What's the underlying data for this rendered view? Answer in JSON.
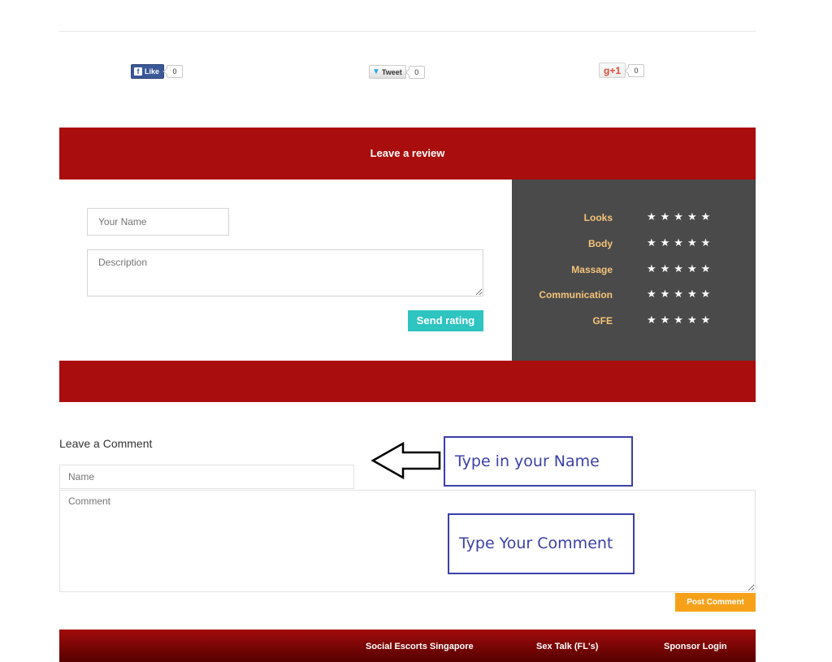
{
  "share": {
    "facebook": {
      "label": "Like",
      "count": "0"
    },
    "twitter": {
      "label": "Tweet",
      "count": "0"
    },
    "google": {
      "label": "g+1",
      "count": "0"
    }
  },
  "review": {
    "title": "Leave a review",
    "name_placeholder": "Your Name",
    "description_placeholder": "Description",
    "send_label": "Send rating",
    "stars_glyph": "★★★★★",
    "categories": [
      "Looks",
      "Body",
      "Massage",
      "Communication",
      "GFE"
    ]
  },
  "comment": {
    "heading": "Leave a Comment",
    "name_placeholder": "Name",
    "comment_placeholder": "Comment",
    "post_label": "Post Comment"
  },
  "annotations": {
    "name_callout": "Type in your Name",
    "comment_callout": "Type Your Comment"
  },
  "footer": {
    "links": [
      "Social Escorts Singapore",
      "Sex Talk (FL's)",
      "Sponsor Login"
    ]
  },
  "colors": {
    "brand_red": "#a90d0d",
    "ratings_bg": "#4a4a4a",
    "rating_label": "#f5c47a",
    "send_button": "#2ec4c0",
    "post_button": "#f7a11a",
    "callout": "#3b3fa8"
  }
}
